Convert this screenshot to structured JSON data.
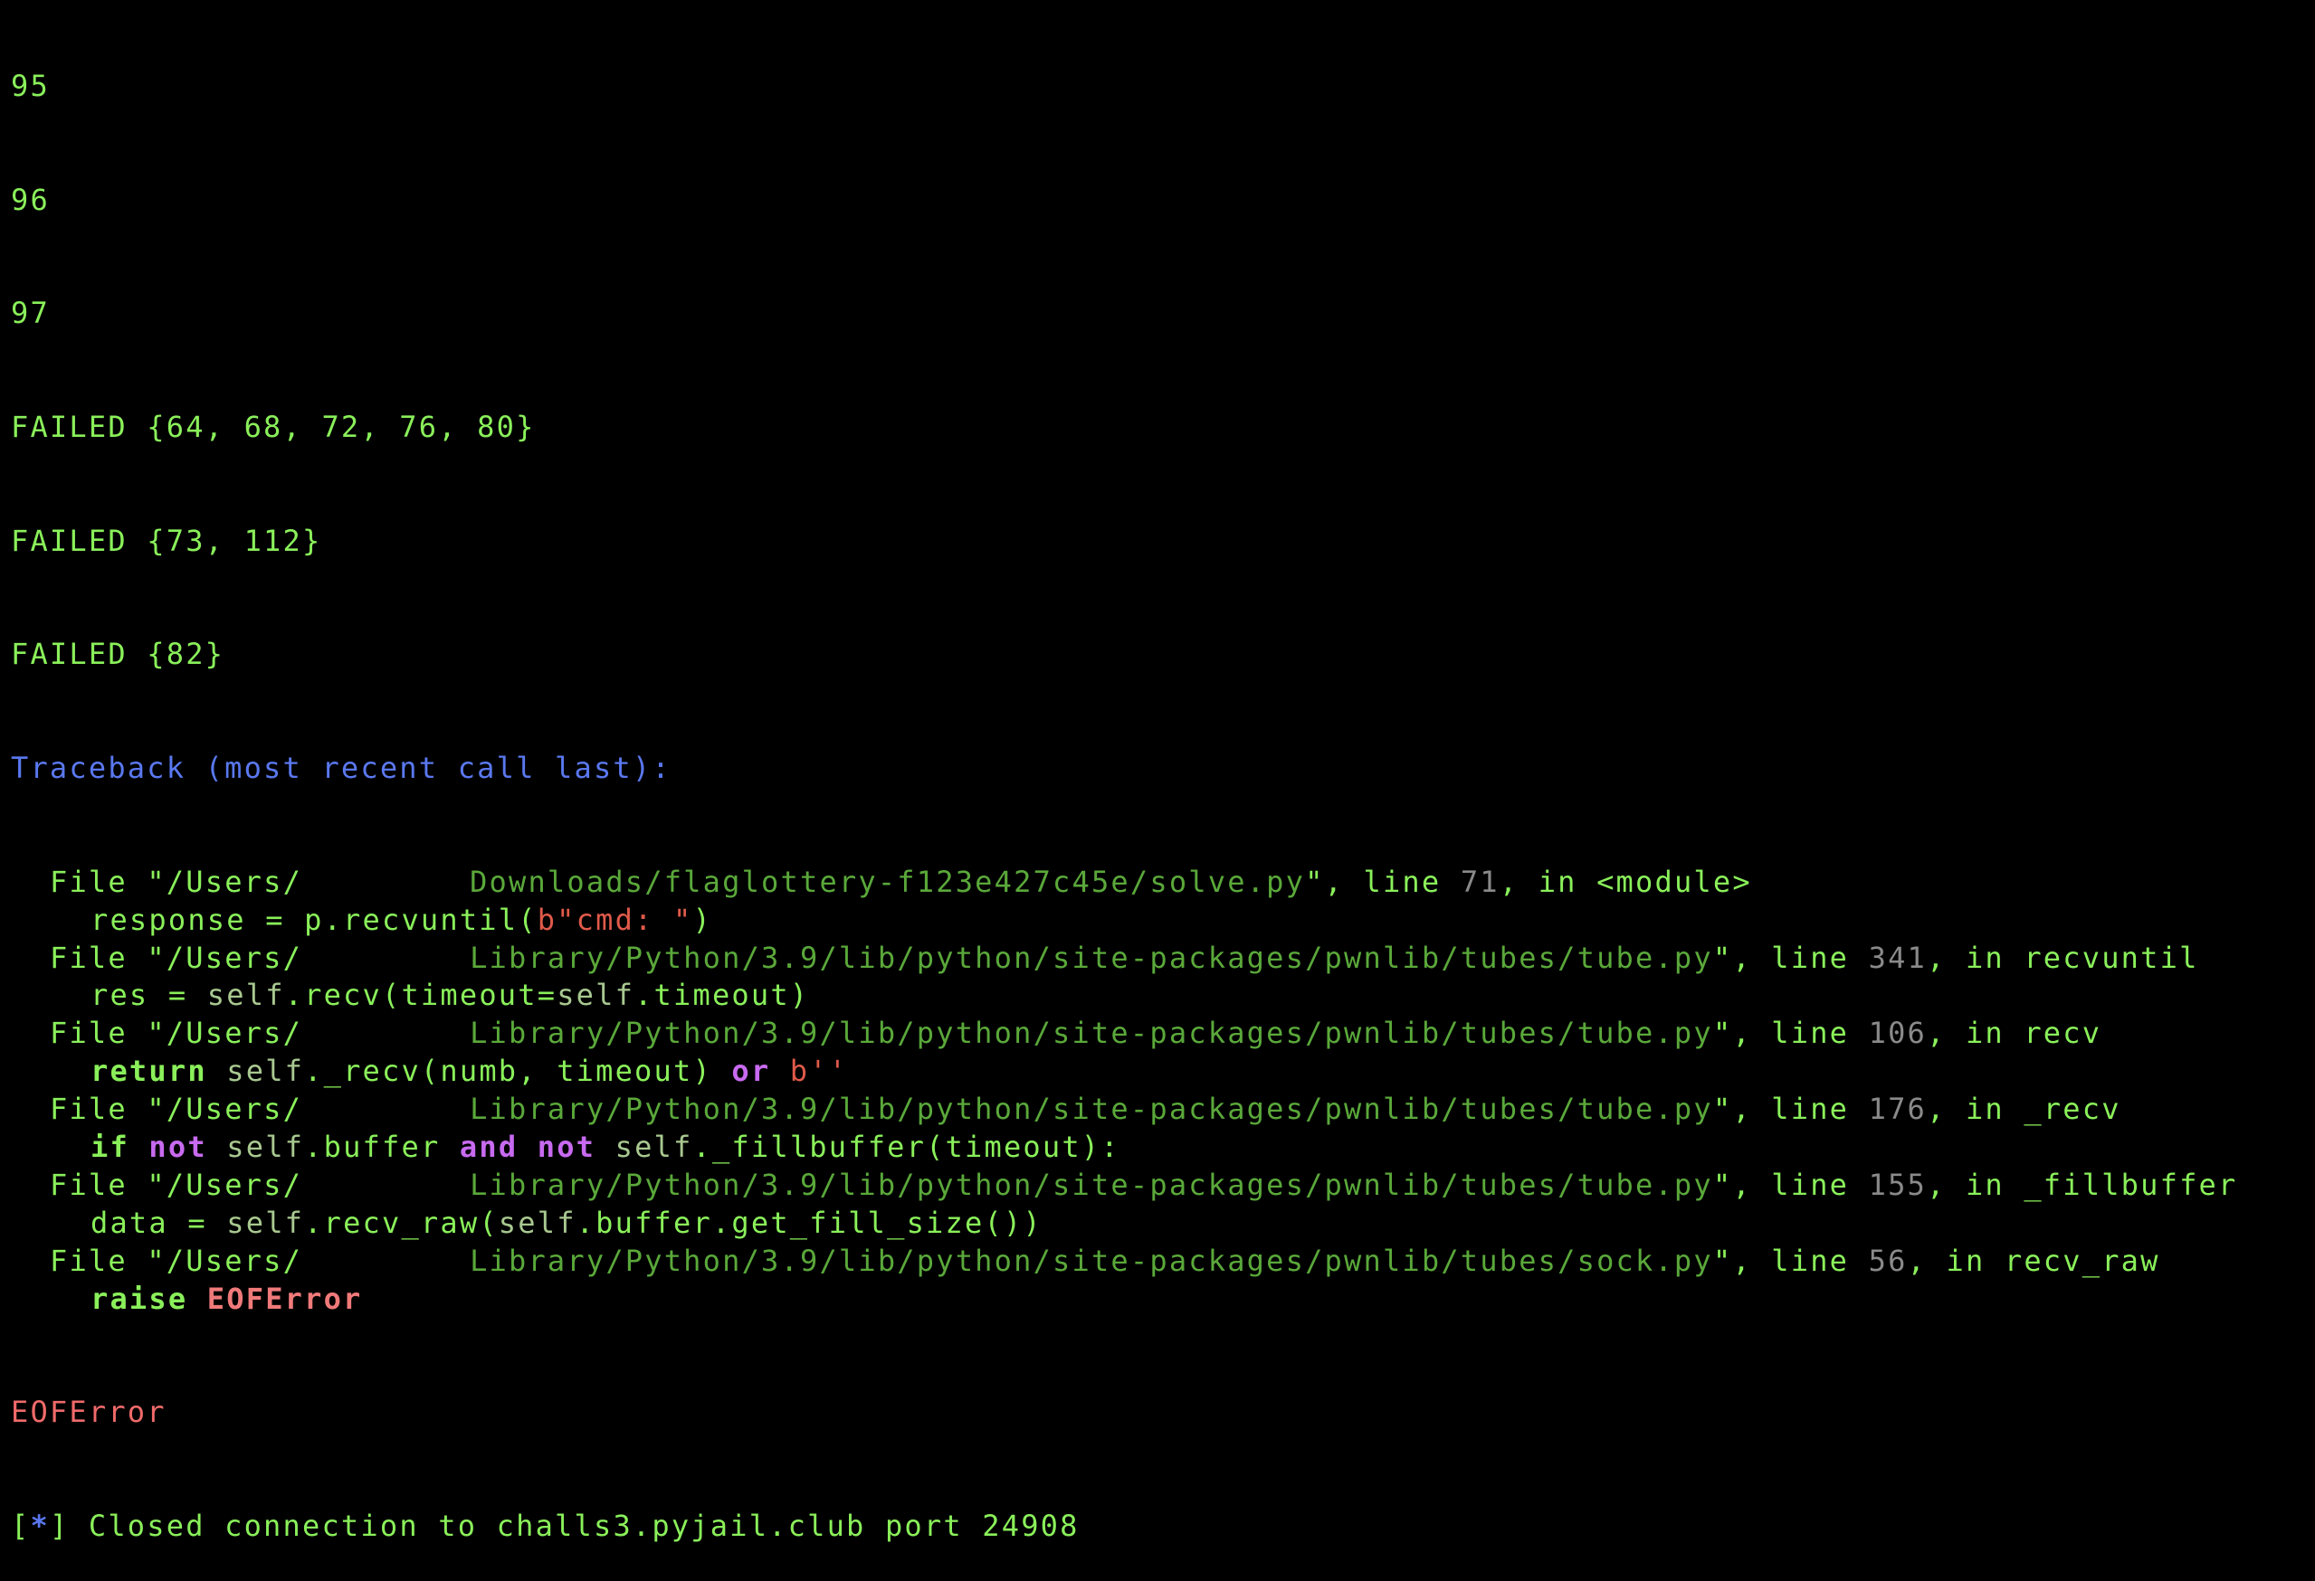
{
  "terminal": {
    "num_lines": [
      "95",
      "96",
      "97"
    ],
    "failed_lines": [
      "FAILED {64, 68, 72, 76, 80}",
      "FAILED {73, 112}",
      "FAILED {82}"
    ],
    "traceback_header": "Traceback (most recent call last):",
    "frames": [
      {
        "file_prefix": "File \"/Users/",
        "file_path": "Downloads/flaglottery-f123e427c45e/solve.py",
        "file_suffix": "\", line ",
        "line_no": "71",
        "in_text": ", in ",
        "func": "<module>",
        "code": [
          {
            "t": "response = p.recvuntil(",
            "c": "green"
          },
          {
            "t": "b\"cmd: \"",
            "c": "redstr"
          },
          {
            "t": ")",
            "c": "green"
          }
        ]
      },
      {
        "file_prefix": "File \"/Users/",
        "file_path": "Library/Python/3.9/lib/python/site-packages/pwnlib/tubes/tube.py",
        "file_suffix": "\", line ",
        "line_no": "341",
        "in_text": ", in ",
        "func": "recvuntil",
        "code": [
          {
            "t": "res = ",
            "c": "green"
          },
          {
            "t": "self",
            "c": "olive"
          },
          {
            "t": ".recv(timeout=",
            "c": "green"
          },
          {
            "t": "self",
            "c": "olive"
          },
          {
            "t": ".timeout)",
            "c": "green"
          }
        ]
      },
      {
        "file_prefix": "File \"/Users/",
        "file_path": "Library/Python/3.9/lib/python/site-packages/pwnlib/tubes/tube.py",
        "file_suffix": "\", line ",
        "line_no": "106",
        "in_text": ", in ",
        "func": "recv",
        "code": [
          {
            "t": "return ",
            "c": "green bold"
          },
          {
            "t": "self",
            "c": "olive"
          },
          {
            "t": "._recv(numb, timeout) ",
            "c": "green"
          },
          {
            "t": "or ",
            "c": "magenta"
          },
          {
            "t": "b''",
            "c": "redstr"
          }
        ]
      },
      {
        "file_prefix": "File \"/Users/",
        "file_path": "Library/Python/3.9/lib/python/site-packages/pwnlib/tubes/tube.py",
        "file_suffix": "\", line ",
        "line_no": "176",
        "in_text": ", in ",
        "func": "_recv",
        "code": [
          {
            "t": "if ",
            "c": "green bold"
          },
          {
            "t": "not ",
            "c": "magenta"
          },
          {
            "t": "self",
            "c": "olive"
          },
          {
            "t": ".buffer ",
            "c": "green"
          },
          {
            "t": "and not ",
            "c": "magenta"
          },
          {
            "t": "self",
            "c": "olive"
          },
          {
            "t": "._fillbuffer(timeout):",
            "c": "green"
          }
        ]
      },
      {
        "file_prefix": "File \"/Users/",
        "file_path": "Library/Python/3.9/lib/python/site-packages/pwnlib/tubes/tube.py",
        "file_suffix": "\", line ",
        "line_no": "155",
        "in_text": ", in ",
        "func": "_fillbuffer",
        "code": [
          {
            "t": "data = ",
            "c": "green"
          },
          {
            "t": "self",
            "c": "olive"
          },
          {
            "t": ".recv_raw(",
            "c": "green"
          },
          {
            "t": "self",
            "c": "olive"
          },
          {
            "t": ".buffer.get_fill_size())",
            "c": "green"
          }
        ]
      },
      {
        "file_prefix": "File \"/Users/",
        "file_path": "Library/Python/3.9/lib/python/site-packages/pwnlib/tubes/sock.py",
        "file_suffix": "\", line ",
        "line_no": "56",
        "in_text": ", in ",
        "func": "recv_raw",
        "code": [
          {
            "t": "raise ",
            "c": "green bold"
          },
          {
            "t": "EOFError",
            "c": "pink"
          }
        ]
      }
    ],
    "exception": "EOFError",
    "closed": {
      "open_bracket": "[",
      "star": "*",
      "close_bracket": "]",
      "message": " Closed connection to challs3.pyjail.club port 24908"
    }
  },
  "colors": {
    "background": "#000000",
    "green": "#8af05a",
    "blue": "#5a78f0",
    "red": "#f06a6a",
    "magenta": "#c86af0"
  }
}
